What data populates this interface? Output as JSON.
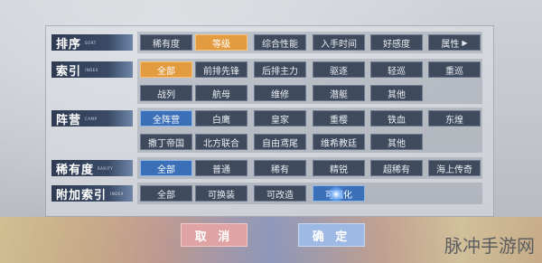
{
  "rows": [
    {
      "label": "排序",
      "sub": "SORT",
      "buttons": [
        {
          "label": "稀有度",
          "state": "normal"
        },
        {
          "label": "等级",
          "state": "orange"
        },
        {
          "label": "综合性能",
          "state": "normal"
        },
        {
          "label": "入手时间",
          "state": "normal"
        },
        {
          "label": "好感度",
          "state": "normal"
        },
        {
          "label": "属性",
          "state": "normal",
          "icon": "chevron-right-icon"
        }
      ]
    },
    {
      "label": "索引",
      "sub": "INDEX",
      "buttons": [
        {
          "label": "全部",
          "state": "orange"
        },
        {
          "label": "前排先锋",
          "state": "normal"
        },
        {
          "label": "后排主力",
          "state": "normal"
        },
        {
          "label": "驱逐",
          "state": "normal"
        },
        {
          "label": "轻巡",
          "state": "normal"
        },
        {
          "label": "重巡",
          "state": "normal"
        },
        {
          "label": "战列",
          "state": "normal"
        },
        {
          "label": "航母",
          "state": "normal"
        },
        {
          "label": "维修",
          "state": "normal"
        },
        {
          "label": "潜艇",
          "state": "normal"
        },
        {
          "label": "其他",
          "state": "normal"
        }
      ]
    },
    {
      "label": "阵营",
      "sub": "CAMP",
      "buttons": [
        {
          "label": "全阵营",
          "state": "blue"
        },
        {
          "label": "白鹰",
          "state": "normal"
        },
        {
          "label": "皇家",
          "state": "normal"
        },
        {
          "label": "重樱",
          "state": "normal"
        },
        {
          "label": "铁血",
          "state": "normal"
        },
        {
          "label": "东煌",
          "state": "normal"
        },
        {
          "label": "撒丁帝国",
          "state": "normal"
        },
        {
          "label": "北方联合",
          "state": "normal"
        },
        {
          "label": "自由鸢尾",
          "state": "normal"
        },
        {
          "label": "维希教廷",
          "state": "normal"
        },
        {
          "label": "其他",
          "state": "normal"
        }
      ]
    },
    {
      "label": "稀有度",
      "sub": "RARITY",
      "buttons": [
        {
          "label": "全部",
          "state": "blue"
        },
        {
          "label": "普通",
          "state": "normal"
        },
        {
          "label": "稀有",
          "state": "normal"
        },
        {
          "label": "精锐",
          "state": "normal"
        },
        {
          "label": "超稀有",
          "state": "normal"
        },
        {
          "label": "海上传奇",
          "state": "normal"
        }
      ]
    },
    {
      "label": "附加索引",
      "sub": "INDEX",
      "buttons": [
        {
          "label": "全部",
          "state": "normal"
        },
        {
          "label": "可换装",
          "state": "normal"
        },
        {
          "label": "可改造",
          "state": "normal"
        },
        {
          "label": "可强化",
          "state": "blue"
        }
      ]
    }
  ],
  "footer": {
    "cancel": "取 消",
    "confirm": "确 定"
  },
  "watermark": "脉冲手游网",
  "colors": {
    "orange": "#e39b3f",
    "blue": "#3b6fb8",
    "button": "#3f4b5d",
    "label_bar": "#2f3b52"
  }
}
